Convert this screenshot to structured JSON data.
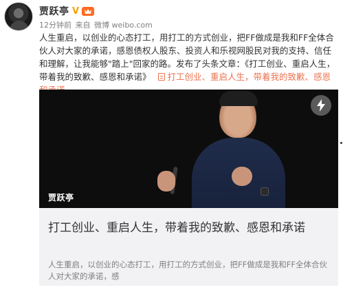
{
  "post": {
    "author_name": "贾跃亭",
    "verified_badge": "V",
    "vip_icon": "vip-level-icon",
    "time": "12分钟前",
    "source_prefix": "来自",
    "source": "微博 weibo.com",
    "text_main": "人生重启，以创业的心态打工，用打工的方式创业，把FF做成是我和FF全体合伙人对大家的承诺，感恩债权人股东、投资人和乐视网股民对我的支持、信任和理解，让我能够\"踏上\"回家的路。发布了头条文章：《打工创业、重启人生，带着我的致歉、感恩和承诺》",
    "article_link": "打工创业、重启人生，带着我的致歉、感恩和承诺"
  },
  "card": {
    "image_author": "贾跃亭",
    "title": "打工创业、重启人生，带着我的致歉、感恩和承诺",
    "summary": "人生重启，以创业的心态打工，用打工的方式创业，把FF做成是我和FF全体合伙人对大家的承诺，感",
    "flash_icon": "lightning-icon"
  },
  "colors": {
    "link": "#eb7350",
    "text": "#333333",
    "meta": "#808080",
    "card_bg": "#f2f2f5",
    "verified": "#f7a100"
  }
}
